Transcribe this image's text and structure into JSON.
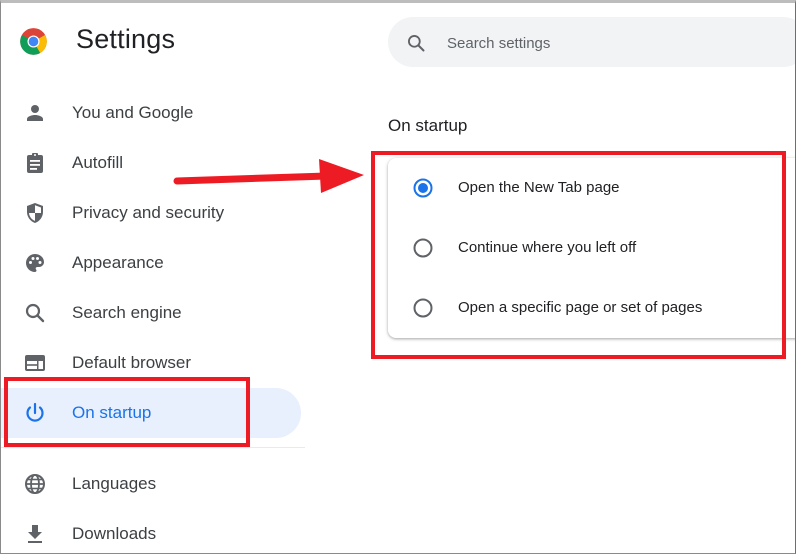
{
  "header": {
    "title": "Settings",
    "logo": "chrome-logo"
  },
  "search": {
    "placeholder": "Search settings",
    "value": "",
    "icon": "search-icon"
  },
  "sidebar": {
    "items": [
      {
        "label": "You and Google",
        "icon": "person-icon",
        "active": false
      },
      {
        "label": "Autofill",
        "icon": "clipboard-icon",
        "active": false
      },
      {
        "label": "Privacy and security",
        "icon": "shield-icon",
        "active": false
      },
      {
        "label": "Appearance",
        "icon": "palette-icon",
        "active": false
      },
      {
        "label": "Search engine",
        "icon": "search-icon",
        "active": false
      },
      {
        "label": "Default browser",
        "icon": "browser-window-icon",
        "active": false
      },
      {
        "label": "On startup",
        "icon": "power-icon",
        "active": true
      },
      {
        "label": "Languages",
        "icon": "globe-icon",
        "active": false
      },
      {
        "label": "Downloads",
        "icon": "download-icon",
        "active": false
      }
    ]
  },
  "main": {
    "section_title": "On startup",
    "options": [
      {
        "label": "Open the New Tab page",
        "selected": true
      },
      {
        "label": "Continue where you left off",
        "selected": false
      },
      {
        "label": "Open a specific page or set of pages",
        "selected": false
      }
    ]
  },
  "colors": {
    "accent": "#1a73e8",
    "active_bg": "#e8f0fe",
    "annotation": "#ed1c24",
    "text": "#3c4043",
    "icon": "#5f6368"
  }
}
